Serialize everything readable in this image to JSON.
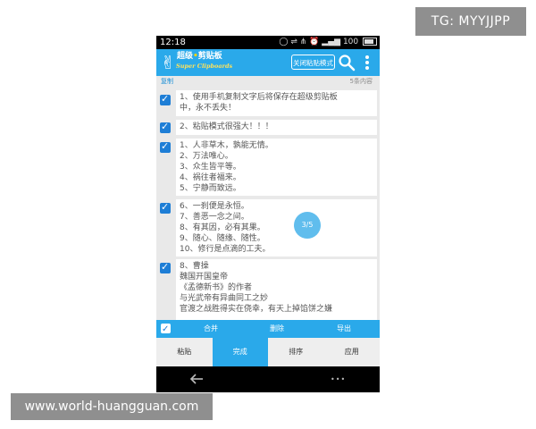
{
  "watermarks": {
    "top": "TG: MYYJJPP",
    "bottom": "www.world-huangguan.com"
  },
  "status_bar": {
    "time": "12:18",
    "signal_text": "100",
    "icons": [
      "chat-icon",
      "usb-icon",
      "share-icon",
      "alarm-icon",
      "signal-icon",
      "battery-icon"
    ]
  },
  "app_bar": {
    "title_part1": "超级",
    "title_part2": "剪贴板",
    "subtitle": "Super Clipboards",
    "mode_button": "关闭粘贴模式",
    "accent": "#2aa9ea"
  },
  "sub_bar": {
    "left": "复制",
    "right": "5条内容"
  },
  "items": [
    {
      "lines": [
        "  1、使用手机复制文字后将保存在超级剪贴板",
        "中，永不丢失！"
      ]
    },
    {
      "lines": [
        "  2、粘贴模式很强大！！！"
      ]
    },
    {
      "lines": [
        "    1、人非草木，孰能无情。",
        "    2、万法唯心。",
        "    3、众生皆平等。",
        "    4、祸往者福来。",
        "    5、宁静而致远。"
      ]
    },
    {
      "lines": [
        "    6、一刹便是永恒。",
        "    7、善恶一念之间。",
        "    8、有其因，必有其果。",
        "    9、随心、随缘、随性。",
        "    10、修行是点滴的工夫。"
      ]
    },
    {
      "lines": [
        "  8、曹操",
        "    魏国开国皇帝",
        "    《孟德新书》的作者",
        "    与光武帝有异曲同工之妙",
        "    官渡之战胜得实在侥幸，有天上掉馅饼之嫌"
      ]
    }
  ],
  "page_indicator": "3/5",
  "action_bar": {
    "merge": "合并",
    "delete": "删除",
    "export": "导出"
  },
  "tabs": [
    {
      "label": "粘贴",
      "active": false
    },
    {
      "label": "完成",
      "active": true
    },
    {
      "label": "排序",
      "active": false
    },
    {
      "label": "应用",
      "active": false
    }
  ],
  "nav": {
    "more": "•••"
  }
}
